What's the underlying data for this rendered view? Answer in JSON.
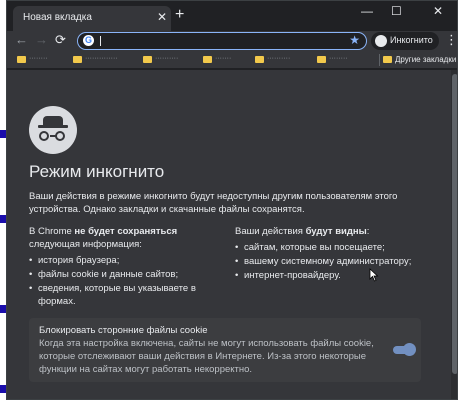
{
  "tab": {
    "title": "Новая вкладка",
    "close": "✕",
    "new_tab": "+"
  },
  "window_controls": {
    "minimize": "—",
    "maximize": "☐",
    "close": "✕"
  },
  "toolbar": {
    "back": "←",
    "forward": "→",
    "reload": "⟳",
    "omnibox_value": "",
    "star": "★",
    "incognito_label": "Инкогнито",
    "menu": "⋮"
  },
  "bookmarks": {
    "items": [
      {
        "label": "········"
      },
      {
        "label": "··············"
      },
      {
        "label": "··········"
      },
      {
        "label": "·······"
      },
      {
        "label": "··········"
      },
      {
        "label": "········"
      }
    ],
    "other_label": "Другие закладки"
  },
  "page": {
    "title": "Режим инкогнито",
    "lead": "Ваши действия в режиме инкогнито будут недоступны другим пользователям этого устройства. Однако закладки и скачанные файлы сохранятся.",
    "left": {
      "head_prefix": "В Chrome ",
      "head_bold": "не будет сохраняться",
      "head_suffix": "следующая информация:",
      "items": [
        "история браузера;",
        "файлы cookie и данные сайтов;",
        "сведения, которые вы указываете в формах."
      ]
    },
    "right": {
      "head_prefix": "Ваши действия ",
      "head_bold": "будут видны",
      "head_suffix": ":",
      "items": [
        "сайтам, которые вы посещаете;",
        "вашему системному администратору;",
        "интернет-провайдеру."
      ]
    },
    "cookie": {
      "title": "Блокировать сторонние файлы cookie",
      "description": "Когда эта настройка включена, сайты не могут использовать файлы cookie, которые отслеживают ваши действия в Интернете. Из-за этого некоторые функции на сайтах могут работать некорректно.",
      "enabled": true
    }
  },
  "colors": {
    "window_bg": "#202124",
    "content_bg": "#35363a",
    "accent": "#8ab4f8",
    "text": "#e8eaed"
  }
}
